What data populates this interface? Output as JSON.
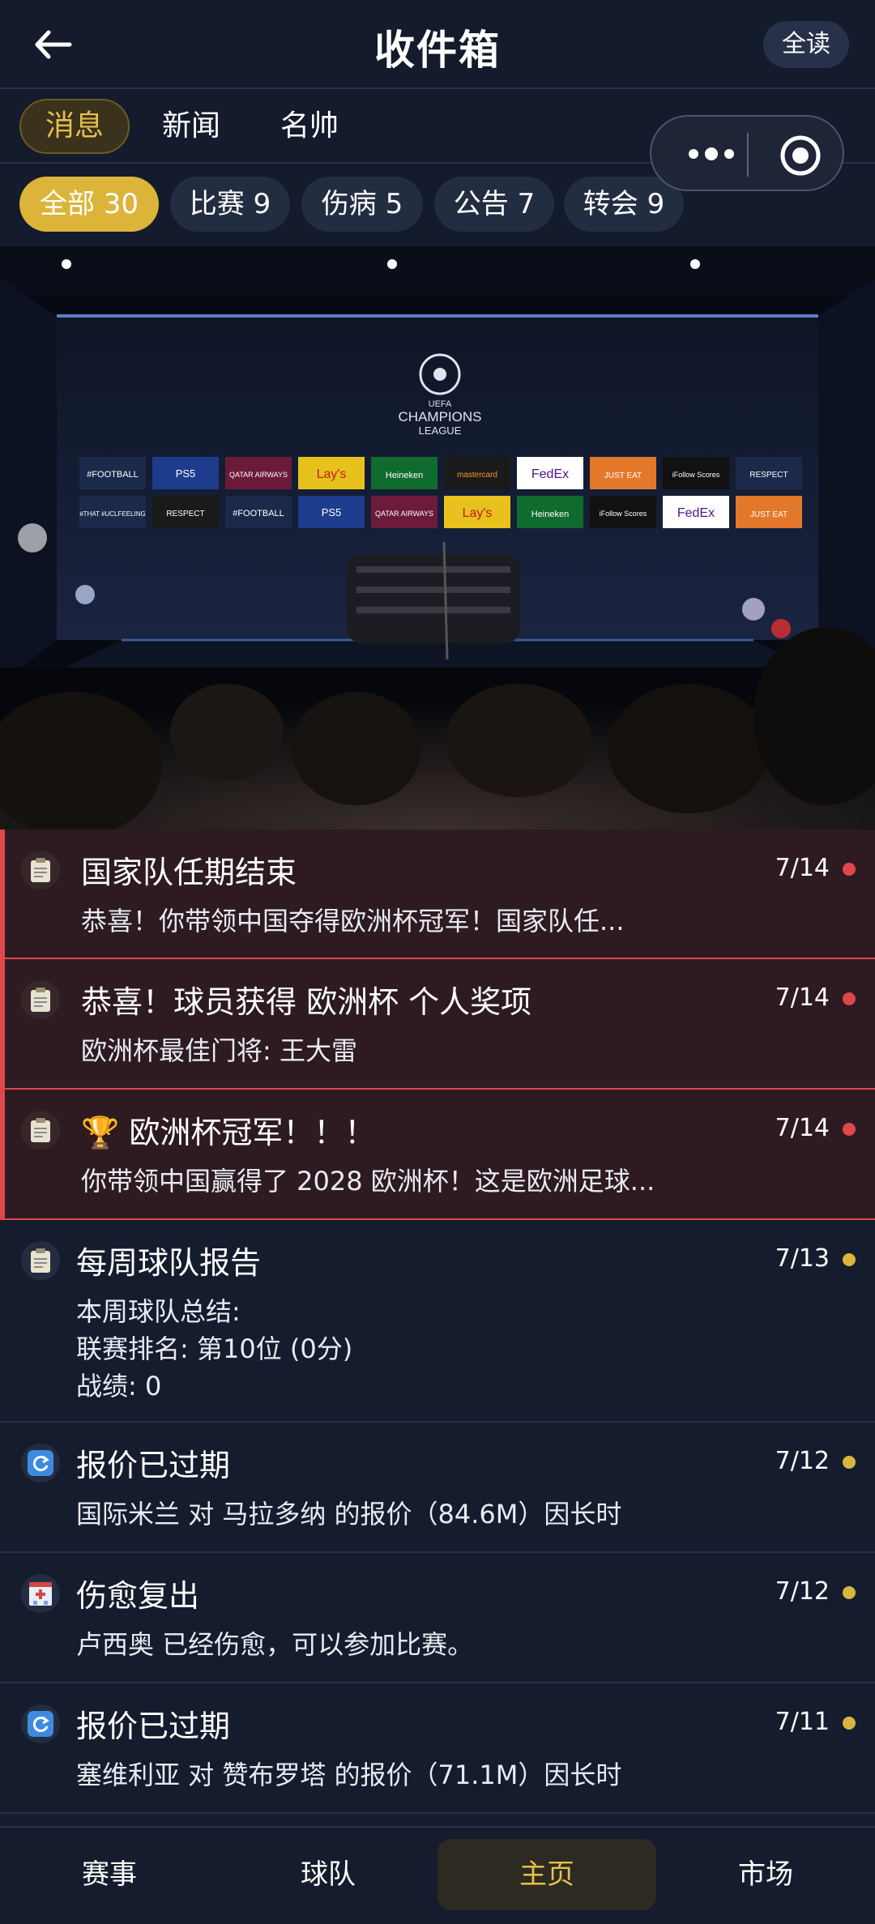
{
  "header": {
    "title": "收件箱",
    "read_all": "全读"
  },
  "tabs": [
    {
      "label": "消息",
      "active": true
    },
    {
      "label": "新闻",
      "active": false
    },
    {
      "label": "名帅",
      "active": false
    }
  ],
  "filters": [
    {
      "label": "全部 30",
      "active": true
    },
    {
      "label": "比赛 9"
    },
    {
      "label": "伤病 5"
    },
    {
      "label": "公告 7"
    },
    {
      "label": "转会 9"
    }
  ],
  "hero": {
    "logo_lines": [
      "UEFA",
      "CHAMPIONS",
      "LEAGUE"
    ],
    "sponsors_row1": [
      "#FOOTBALL",
      "PS5",
      "QATAR AIRWAYS",
      "Lay's",
      "Heineken",
      "mastercard",
      "FedEx",
      "JUST EAT",
      "iFollow Scores",
      "RESPECT"
    ],
    "sponsors_row2": [
      "#THAT #UCLFEELING",
      "RESPECT",
      "#FOOTBALL",
      "PS5",
      "QATAR AIRWAYS",
      "Lay's",
      "Heineken",
      "iFollow Scores",
      "FedEx",
      "JUST EAT"
    ]
  },
  "messages": [
    {
      "icon": "clipboard-icon",
      "title": "国家队任期结束",
      "date": "7/14",
      "body": "恭喜！你带领中国夺得欧洲杯冠军！国家队任...",
      "style": "unread-red",
      "dot": "#e0474a"
    },
    {
      "icon": "clipboard-icon",
      "title": "恭喜！球员获得 欧洲杯 个人奖项",
      "date": "7/14",
      "body": "欧洲杯最佳门将: 王大雷",
      "style": "unread-red",
      "dot": "#e0474a"
    },
    {
      "icon": "clipboard-icon",
      "title": "🏆 欧洲杯冠军！！！",
      "date": "7/14",
      "body": "你带领中国赢得了 2028 欧洲杯！这是欧洲足球...",
      "style": "unread-red",
      "dot": "#e0474a"
    },
    {
      "icon": "clipboard-icon",
      "title": "每周球队报告",
      "date": "7/13",
      "body": "本周球队总结:\n联赛排名: 第10位 (0分)\n战绩: 0",
      "style": "normal",
      "dot": "#d9b53c"
    },
    {
      "icon": "refresh-icon",
      "title": "报价已过期",
      "date": "7/12",
      "body": "国际米兰 对 马拉多纳 的报价（84.6M）因长时",
      "style": "normal",
      "dot": "#d9b53c"
    },
    {
      "icon": "hospital-icon",
      "title": "伤愈复出",
      "date": "7/12",
      "body": "卢西奥 已经伤愈，可以参加比赛。",
      "style": "normal",
      "dot": "#d9b53c"
    },
    {
      "icon": "refresh-icon",
      "title": "报价已过期",
      "date": "7/11",
      "body": "塞维利亚 对 赞布罗塔 的报价（71.1M）因长时",
      "style": "normal",
      "dot": "#d9b53c"
    }
  ],
  "bottom_nav": [
    {
      "label": "赛事"
    },
    {
      "label": "球队"
    },
    {
      "label": "主页",
      "active": true
    },
    {
      "label": "市场"
    }
  ],
  "colors": {
    "accent": "#dcb43a",
    "unread_red": "#e0474a",
    "background": "#141c2e"
  }
}
